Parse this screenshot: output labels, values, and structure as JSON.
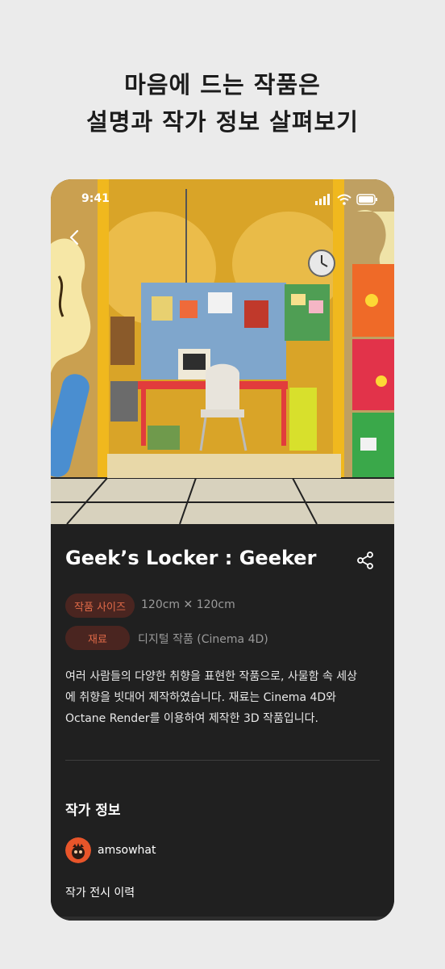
{
  "headline": {
    "line1": "마음에 드는 작품은",
    "line2": "설명과 작가 정보 살펴보기"
  },
  "status_bar": {
    "time": "9:41",
    "icons": [
      "signal-icon",
      "wifi-icon",
      "battery-icon"
    ]
  },
  "navigation": {
    "back_icon": "chevron-left-icon"
  },
  "artwork": {
    "title": "Geek’s Locker : Geeker",
    "share_icon": "share-icon",
    "size_label": "작품 사이즈",
    "size_value": "120cm ✕ 120cm",
    "material_label": "재료",
    "material_value": "디지털 작품 (Cinema 4D)",
    "description_lines": [
      "여러 사람들의 다양한 취향을 표현한 작품으로, 사물함 속 세상",
      "에 취향을 빗대어 제작하였습니다. 재료는 Cinema 4D와",
      "Octane Render를 이용하여 제작한 3D 작품입니다."
    ]
  },
  "artist": {
    "section_title": "작가 정보",
    "name": "amsowhat",
    "exhibition_history_label": "작가 전시 이력"
  },
  "colors": {
    "page_background": "#ebebeb",
    "panel_background": "#202020",
    "chip_background": "#4a2520",
    "chip_text": "#e06a48",
    "accent_yellow": "#f0b81e"
  }
}
